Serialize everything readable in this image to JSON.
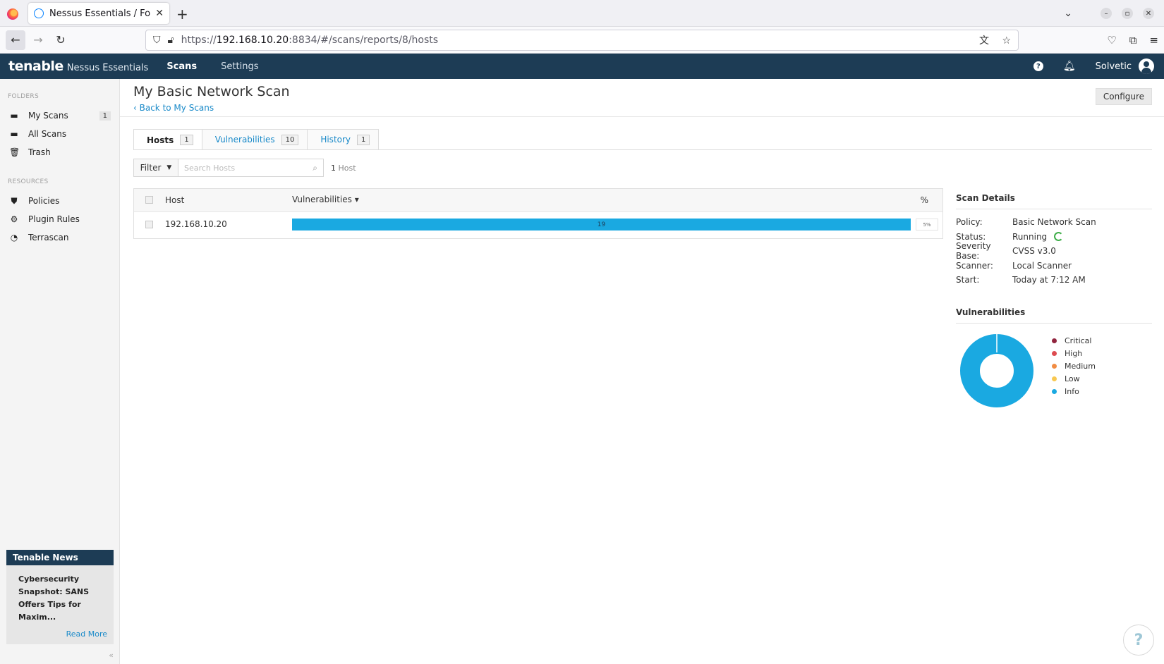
{
  "browser": {
    "tab_title": "Nessus Essentials / Folde",
    "url_prefix": "https://",
    "url_host": "192.168.10.20",
    "url_rest": ":8834/#/scans/reports/8/hosts"
  },
  "header": {
    "brand_logo": "tenable",
    "brand_product": "Nessus Essentials",
    "nav": [
      {
        "label": "Scans",
        "active": true
      },
      {
        "label": "Settings",
        "active": false
      }
    ],
    "user": "Solvetic"
  },
  "sidebar": {
    "folders_heading": "FOLDERS",
    "folders": [
      {
        "label": "My Scans",
        "count": "1",
        "icon": "folder-icon"
      },
      {
        "label": "All Scans",
        "icon": "folder-icon"
      },
      {
        "label": "Trash",
        "icon": "trash-icon"
      }
    ],
    "resources_heading": "RESOURCES",
    "resources": [
      {
        "label": "Policies",
        "icon": "shield-icon"
      },
      {
        "label": "Plugin Rules",
        "icon": "plugin-rules-icon"
      },
      {
        "label": "Terrascan",
        "icon": "terrascan-icon"
      }
    ],
    "news": {
      "title": "Tenable News",
      "body": "Cybersecurity Snapshot: SANS Offers Tips for Maxim...",
      "more": "Read More"
    }
  },
  "main": {
    "title": "My Basic Network Scan",
    "back_link": "Back to My Scans",
    "configure": "Configure",
    "tabs": [
      {
        "label": "Hosts",
        "count": "1",
        "active": true
      },
      {
        "label": "Vulnerabilities",
        "count": "10",
        "active": false
      },
      {
        "label": "History",
        "count": "1",
        "active": false
      }
    ],
    "filter_label": "Filter",
    "search_placeholder": "Search Hosts",
    "host_count_num": "1",
    "host_count_label": "Host",
    "table": {
      "col_host": "Host",
      "col_vuln": "Vulnerabilities",
      "col_pct": "%",
      "rows": [
        {
          "host": "192.168.10.20",
          "vulns": "19",
          "pct": "5%"
        }
      ]
    }
  },
  "details": {
    "title": "Scan Details",
    "rows": [
      {
        "key": "Policy:",
        "value": "Basic Network Scan"
      },
      {
        "key": "Status:",
        "value": "Running"
      },
      {
        "key": "Severity Base:",
        "value": "CVSS v3.0"
      },
      {
        "key": "Scanner:",
        "value": "Local Scanner"
      },
      {
        "key": "Start:",
        "value": "Today at 7:12 AM"
      }
    ]
  },
  "vulnerabilities": {
    "title": "Vulnerabilities",
    "legend": [
      {
        "label": "Critical",
        "color": "#91243e"
      },
      {
        "label": "High",
        "color": "#dd4b50"
      },
      {
        "label": "Medium",
        "color": "#f18c43"
      },
      {
        "label": "Low",
        "color": "#f8c851"
      },
      {
        "label": "Info",
        "color": "#1aa9e1"
      }
    ]
  }
}
